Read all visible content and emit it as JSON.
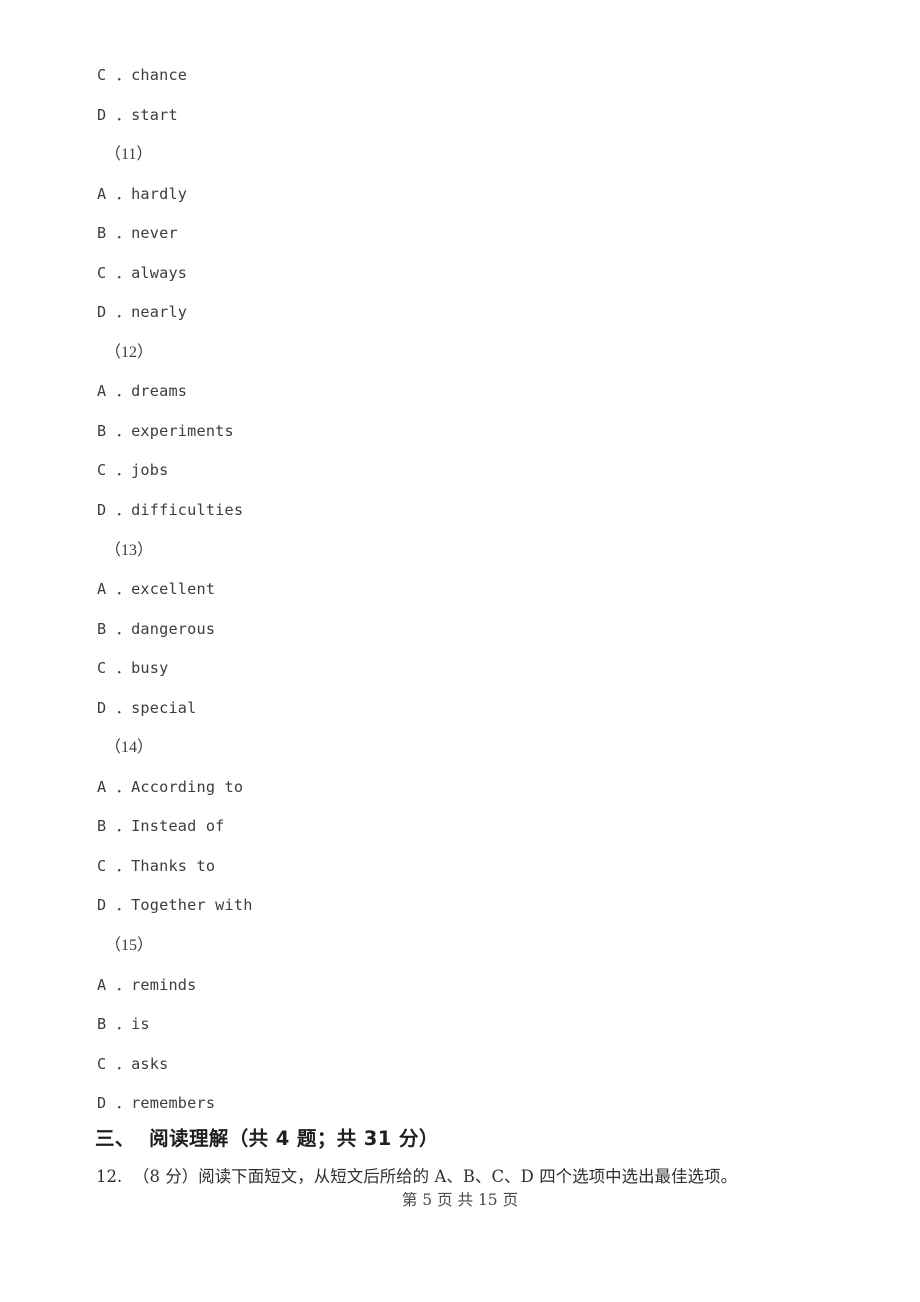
{
  "page": {
    "background_color": "#ffffff",
    "text_color": "#3b3b3b",
    "footer": "第 5 页 共 15 页"
  },
  "body_lines": [
    {
      "type": "option",
      "text": "C ．chance"
    },
    {
      "type": "option",
      "text": "D ．start"
    },
    {
      "type": "group",
      "text": "（11）"
    },
    {
      "type": "option",
      "text": "A ．hardly"
    },
    {
      "type": "option",
      "text": "B ．never"
    },
    {
      "type": "option",
      "text": "C ．always"
    },
    {
      "type": "option",
      "text": "D ．nearly"
    },
    {
      "type": "group",
      "text": "（12）"
    },
    {
      "type": "option",
      "text": "A ．dreams"
    },
    {
      "type": "option",
      "text": "B ．experiments"
    },
    {
      "type": "option",
      "text": "C ．jobs"
    },
    {
      "type": "option",
      "text": "D ．difficulties"
    },
    {
      "type": "group",
      "text": "（13）"
    },
    {
      "type": "option",
      "text": "A ．excellent"
    },
    {
      "type": "option",
      "text": "B ．dangerous"
    },
    {
      "type": "option",
      "text": "C ．busy"
    },
    {
      "type": "option",
      "text": "D ．special"
    },
    {
      "type": "group",
      "text": "（14）"
    },
    {
      "type": "option",
      "text": "A ．According to"
    },
    {
      "type": "option",
      "text": "B ．Instead of"
    },
    {
      "type": "option",
      "text": "C ．Thanks to"
    },
    {
      "type": "option",
      "text": "D ．Together with"
    },
    {
      "type": "group",
      "text": "（15）"
    },
    {
      "type": "option",
      "text": "A ．reminds"
    },
    {
      "type": "option",
      "text": "B ．is"
    },
    {
      "type": "option",
      "text": "C ．asks"
    },
    {
      "type": "option",
      "text": "D ．remembers"
    }
  ],
  "section": {
    "heading": "三、  阅读理解（共 4 题；共 31 分）"
  },
  "question": {
    "number": "12.",
    "text": "12.  （8 分）阅读下面短文，从短文后所给的 A、B、C、D 四个选项中选出最佳选项。"
  }
}
